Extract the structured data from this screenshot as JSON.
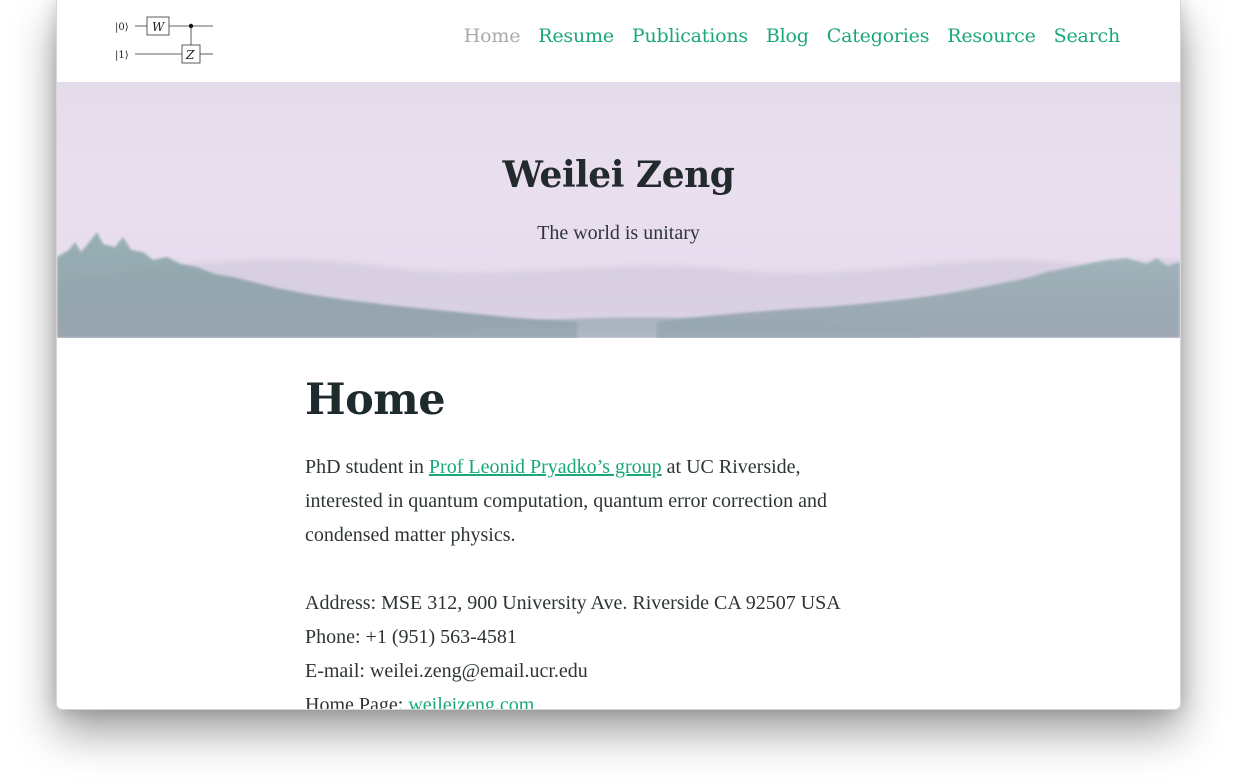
{
  "logo": {
    "ket0": "|0⟩",
    "ket1": "|1⟩",
    "gate_w": "W",
    "gate_z": "Z"
  },
  "nav": {
    "items": [
      {
        "label": "Home",
        "active": true
      },
      {
        "label": "Resume",
        "active": false
      },
      {
        "label": "Publications",
        "active": false
      },
      {
        "label": "Blog",
        "active": false
      },
      {
        "label": "Categories",
        "active": false
      },
      {
        "label": "Resource",
        "active": false
      },
      {
        "label": "Search",
        "active": false
      }
    ]
  },
  "hero": {
    "title": "Weilei Zeng",
    "subtitle": "The world is unitary"
  },
  "main": {
    "title": "Home",
    "intro_prefix": "PhD student in ",
    "intro_link": "Prof Leonid Pryadko’s group",
    "intro_line1_suffix": " at UC Riverside,",
    "intro_line2": "interested in quantum computation, quantum error correction and",
    "intro_line3": "condensed matter physics.",
    "address": "Address: MSE 312, 900 University Ave. Riverside CA 92507 USA",
    "phone": "Phone: +1 (951) 563-4581",
    "email": "E-mail: weilei.zeng@email.ucr.edu",
    "homepage_label": "Home Page: ",
    "homepage_link": "weileizeng.com"
  },
  "colors": {
    "accent": "#1aa879",
    "nav_active": "#a9a9a9",
    "text": "#2d3436"
  }
}
